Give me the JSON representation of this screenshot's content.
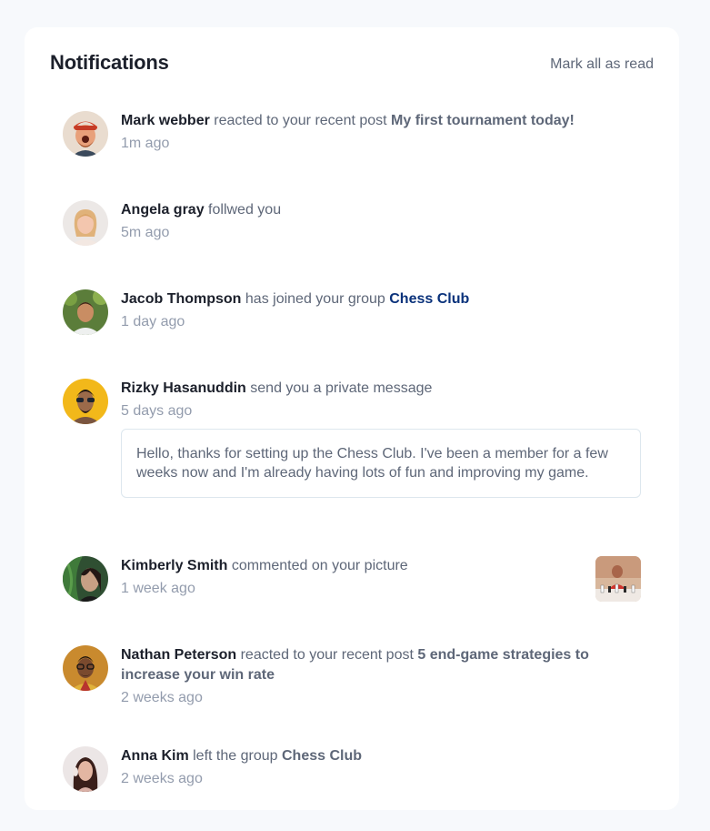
{
  "header": {
    "title": "Notifications",
    "mark_all_label": "Mark all as read"
  },
  "notifications": [
    {
      "name": "Mark webber",
      "action": "reacted to your recent post",
      "target": "My first tournament today!",
      "time": "1m ago"
    },
    {
      "name": "Angela gray",
      "action": "follwed you",
      "time": "5m ago"
    },
    {
      "name": "Jacob Thompson",
      "action": "has joined your group",
      "target": "Chess Club",
      "time": "1 day ago"
    },
    {
      "name": "Rizky Hasanuddin",
      "action": "send you a private message",
      "time": "5 days ago",
      "message": "Hello, thanks for setting up the Chess Club. I've been a member for a few weeks now and I'm already having lots of fun and improving my game."
    },
    {
      "name": "Kimberly Smith",
      "action": "commented on your picture",
      "time": "1 week ago"
    },
    {
      "name": "Nathan Peterson",
      "action": "reacted to your recent post",
      "target": "5 end-game strategies to increase your win rate",
      "time": "2 weeks ago"
    },
    {
      "name": "Anna Kim",
      "action": "left the group",
      "target": "Chess Club",
      "time": "2 weeks ago"
    }
  ]
}
